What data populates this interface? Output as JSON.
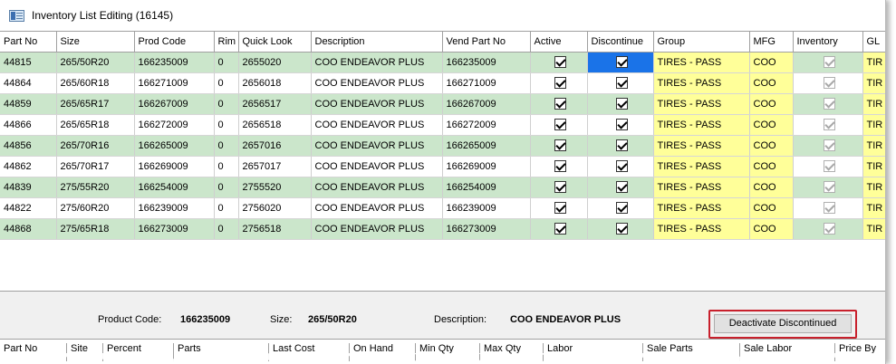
{
  "window": {
    "title": "Inventory List Editing (16145)"
  },
  "grid": {
    "columns": [
      "Part No",
      "Size",
      "Prod Code",
      "Rim",
      "Quick Look",
      "Description",
      "Vend Part No",
      "Active",
      "Discontinue",
      "Group",
      "MFG",
      "Inventory",
      "GL"
    ],
    "rows": [
      {
        "part_no": "44815",
        "size": "265/50R20",
        "prod_code": "166235009",
        "rim": "0",
        "quick_look": "2655020",
        "description": "COO ENDEAVOR PLUS",
        "vend_part_no": "166235009",
        "active": true,
        "discontinue": true,
        "group": "TIRES - PASS",
        "mfg": "COO",
        "inventory": true,
        "gl": "TIR"
      },
      {
        "part_no": "44864",
        "size": "265/60R18",
        "prod_code": "166271009",
        "rim": "0",
        "quick_look": "2656018",
        "description": "COO ENDEAVOR PLUS",
        "vend_part_no": "166271009",
        "active": true,
        "discontinue": true,
        "group": "TIRES - PASS",
        "mfg": "COO",
        "inventory": true,
        "gl": "TIR"
      },
      {
        "part_no": "44859",
        "size": "265/65R17",
        "prod_code": "166267009",
        "rim": "0",
        "quick_look": "2656517",
        "description": "COO ENDEAVOR PLUS",
        "vend_part_no": "166267009",
        "active": true,
        "discontinue": true,
        "group": "TIRES - PASS",
        "mfg": "COO",
        "inventory": true,
        "gl": "TIR"
      },
      {
        "part_no": "44866",
        "size": "265/65R18",
        "prod_code": "166272009",
        "rim": "0",
        "quick_look": "2656518",
        "description": "COO ENDEAVOR PLUS",
        "vend_part_no": "166272009",
        "active": true,
        "discontinue": true,
        "group": "TIRES - PASS",
        "mfg": "COO",
        "inventory": true,
        "gl": "TIR"
      },
      {
        "part_no": "44856",
        "size": "265/70R16",
        "prod_code": "166265009",
        "rim": "0",
        "quick_look": "2657016",
        "description": "COO ENDEAVOR PLUS",
        "vend_part_no": "166265009",
        "active": true,
        "discontinue": true,
        "group": "TIRES - PASS",
        "mfg": "COO",
        "inventory": true,
        "gl": "TIR"
      },
      {
        "part_no": "44862",
        "size": "265/70R17",
        "prod_code": "166269009",
        "rim": "0",
        "quick_look": "2657017",
        "description": "COO ENDEAVOR PLUS",
        "vend_part_no": "166269009",
        "active": true,
        "discontinue": true,
        "group": "TIRES - PASS",
        "mfg": "COO",
        "inventory": true,
        "gl": "TIR"
      },
      {
        "part_no": "44839",
        "size": "275/55R20",
        "prod_code": "166254009",
        "rim": "0",
        "quick_look": "2755520",
        "description": "COO ENDEAVOR PLUS",
        "vend_part_no": "166254009",
        "active": true,
        "discontinue": true,
        "group": "TIRES - PASS",
        "mfg": "COO",
        "inventory": true,
        "gl": "TIR"
      },
      {
        "part_no": "44822",
        "size": "275/60R20",
        "prod_code": "166239009",
        "rim": "0",
        "quick_look": "2756020",
        "description": "COO ENDEAVOR PLUS",
        "vend_part_no": "166239009",
        "active": true,
        "discontinue": true,
        "group": "TIRES - PASS",
        "mfg": "COO",
        "inventory": true,
        "gl": "TIR"
      },
      {
        "part_no": "44868",
        "size": "275/65R18",
        "prod_code": "166273009",
        "rim": "0",
        "quick_look": "2756518",
        "description": "COO ENDEAVOR PLUS",
        "vend_part_no": "166273009",
        "active": true,
        "discontinue": true,
        "group": "TIRES - PASS",
        "mfg": "COO",
        "inventory": true,
        "gl": "TIR"
      }
    ]
  },
  "scrollbar": {
    "left_arrow": "<"
  },
  "details": {
    "product_code_label": "Product Code:",
    "product_code_value": "166235009",
    "size_label": "Size:",
    "size_value": "265/50R20",
    "description_label": "Description:",
    "description_value": "COO ENDEAVOR PLUS"
  },
  "actions": {
    "deactivate_label": "Deactivate Discontinued"
  },
  "lower_grid": {
    "columns": [
      "Part No",
      "Site",
      "Percent",
      "Parts",
      "Last Cost",
      "On Hand",
      "Min Qty",
      "Max Qty",
      "Labor",
      "Sale Parts",
      "Sale Labor",
      "Price By"
    ]
  },
  "colors": {
    "row_band": "#cbe6cb",
    "yellow_cell": "#ffff99",
    "selected_cell": "#1a73e8",
    "highlight": "#c8202c"
  }
}
